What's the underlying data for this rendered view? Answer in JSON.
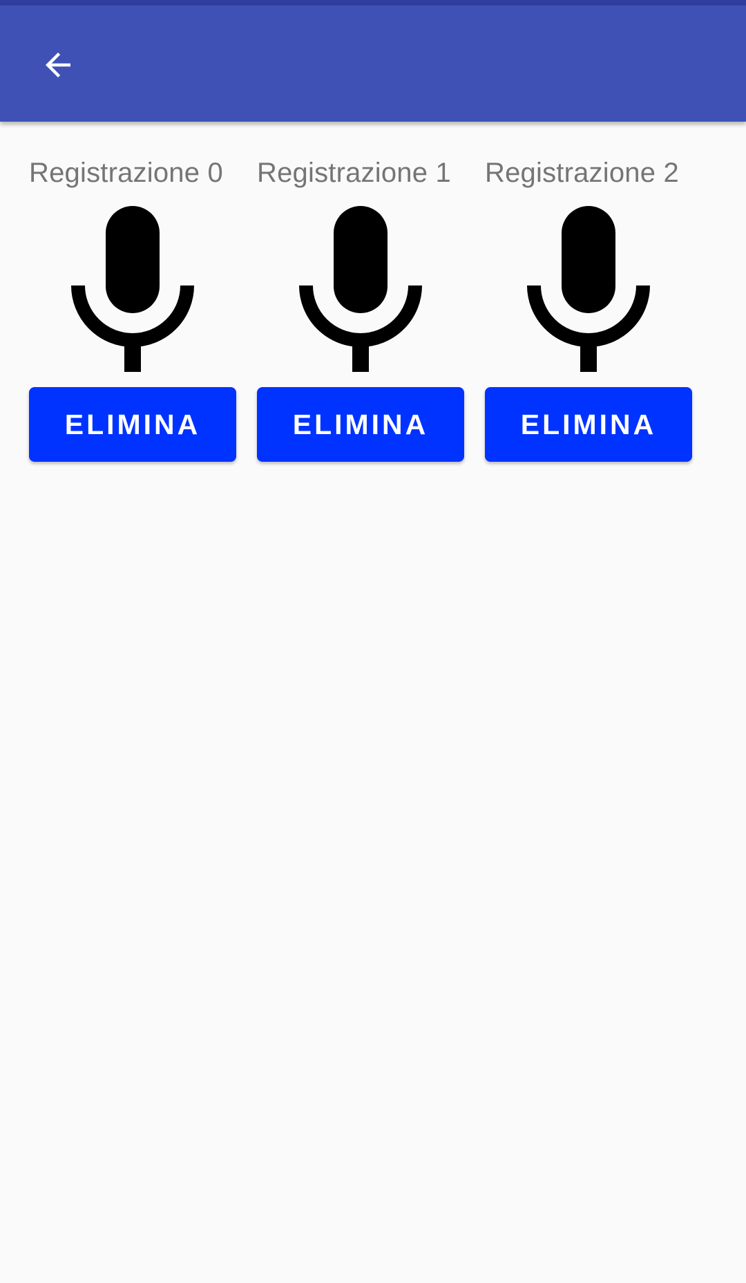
{
  "app_bar": {
    "back_icon": "arrow-back-icon",
    "color": "#3f51b5",
    "status_bar_color": "#303f9f"
  },
  "recordings": [
    {
      "title": "Registrazione 0",
      "icon": "microphone-icon",
      "delete_label": "ELIMINA"
    },
    {
      "title": "Registrazione 1",
      "icon": "microphone-icon",
      "delete_label": "ELIMINA"
    },
    {
      "title": "Registrazione 2",
      "icon": "microphone-icon",
      "delete_label": "ELIMINA"
    }
  ],
  "colors": {
    "button": "#0033ff",
    "title_text": "#757575",
    "background": "#fafafa"
  }
}
